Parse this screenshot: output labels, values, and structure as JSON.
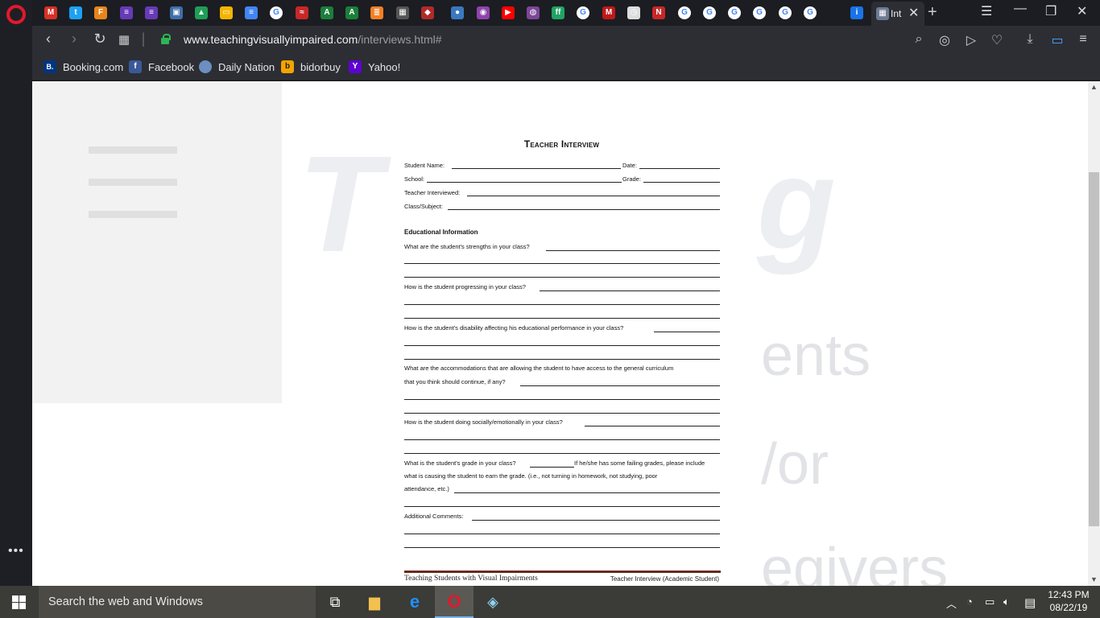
{
  "browser": {
    "active_tab_title": "Int",
    "url_host": "www.teachingvisuallyimpaired.com",
    "url_path": "/interviews.html#",
    "colors": {
      "accent": "#e3182d",
      "lock": "#2fb455",
      "toolbar": "#2c2e34"
    }
  },
  "tabs": [
    {
      "icon": "gmail-icon",
      "color": "#d93025",
      "glyph": "M"
    },
    {
      "icon": "twitter-icon",
      "color": "#1da1f2",
      "glyph": "t"
    },
    {
      "icon": "f-icon",
      "color": "#e8841a",
      "glyph": "F"
    },
    {
      "icon": "list-icon",
      "color": "#673ab7",
      "glyph": "≡"
    },
    {
      "icon": "list-icon",
      "color": "#673ab7",
      "glyph": "≡"
    },
    {
      "icon": "photo-icon",
      "color": "#3f6ea7",
      "glyph": "▣"
    },
    {
      "icon": "drive-icon",
      "color": "#1e9e57",
      "glyph": "▲"
    },
    {
      "icon": "slides-icon",
      "color": "#f4b400",
      "glyph": "▭"
    },
    {
      "icon": "docs-icon",
      "color": "#4285f4",
      "glyph": "≡"
    },
    {
      "icon": "google-icon",
      "color": "#ffffff",
      "glyph": "G"
    },
    {
      "icon": "red-icon",
      "color": "#c62828",
      "glyph": "≈"
    },
    {
      "icon": "green-icon",
      "color": "#1b7f3b",
      "glyph": "A"
    },
    {
      "icon": "green-icon",
      "color": "#1b7f3b",
      "glyph": "A"
    },
    {
      "icon": "stack-icon",
      "color": "#f48024",
      "glyph": "≣"
    },
    {
      "icon": "qr-icon",
      "color": "#555555",
      "glyph": "▦"
    },
    {
      "icon": "shield-icon",
      "color": "#b02a2a",
      "glyph": "◆"
    },
    {
      "icon": "globe-icon",
      "color": "#3b78c2",
      "glyph": "●"
    },
    {
      "icon": "podcast-icon",
      "color": "#8e44ad",
      "glyph": "◉"
    },
    {
      "icon": "youtube-icon",
      "color": "#ff0000",
      "glyph": "▶"
    },
    {
      "icon": "tor-icon",
      "color": "#7d4698",
      "glyph": "◍"
    },
    {
      "icon": "green-icon",
      "color": "#1fa463",
      "glyph": "ff"
    },
    {
      "icon": "google-icon",
      "color": "#ffffff",
      "glyph": "G"
    },
    {
      "icon": "mcafee-icon",
      "color": "#c01818",
      "glyph": "M"
    },
    {
      "icon": "clock-icon",
      "color": "#dddddd",
      "glyph": "◷"
    },
    {
      "icon": "news-icon",
      "color": "#c62828",
      "glyph": "N"
    },
    {
      "icon": "google-icon",
      "color": "#ffffff",
      "glyph": "G"
    },
    {
      "icon": "google-icon",
      "color": "#ffffff",
      "glyph": "G"
    },
    {
      "icon": "google-icon",
      "color": "#ffffff",
      "glyph": "G"
    },
    {
      "icon": "google-icon",
      "color": "#ffffff",
      "glyph": "G"
    },
    {
      "icon": "google-icon",
      "color": "#ffffff",
      "glyph": "G"
    },
    {
      "icon": "google-icon",
      "color": "#ffffff",
      "glyph": "G"
    },
    {
      "icon": "info-icon",
      "color": "#1a73e8",
      "glyph": "i"
    }
  ],
  "bookmarks": [
    {
      "label": "Booking.com",
      "icon": "booking-icon",
      "glyph": "B.",
      "color": "#003580"
    },
    {
      "label": "Facebook",
      "icon": "facebook-icon",
      "glyph": "f",
      "color": "#3b5998"
    },
    {
      "label": "Daily Nation",
      "icon": "globe-icon",
      "glyph": "●",
      "color": "#6c8fbf"
    },
    {
      "label": "bidorbuy",
      "icon": "bidorbuy-icon",
      "glyph": "b",
      "color": "#f5a300"
    },
    {
      "label": "Yahoo!",
      "icon": "yahoo-icon",
      "glyph": "Y",
      "color": "#5f01d1"
    }
  ],
  "page_bg": {
    "big_letters_1": "T",
    "big_letters_2": "g",
    "word_1": "ents",
    "word_2": "/or",
    "word_3": "egivers"
  },
  "document": {
    "title": "Teacher Interview",
    "fields": [
      {
        "label": "Student Name:",
        "right": "Date:"
      },
      {
        "label": "School:",
        "right": "Grade:"
      },
      {
        "label": "Teacher Interviewed:",
        "right": ""
      },
      {
        "label": "Class/Subject:",
        "right": ""
      }
    ],
    "section": "Educational Information",
    "questions": [
      "What are the student's strengths in your class?",
      "How is the student progressing in your class?",
      "How is the student's disability affecting his educational performance in your class?",
      "What are the accommodations that are allowing the student to have access to the general curriculum",
      "that you think should continue, if any?",
      "How is the student doing socially/emotionally in your class?",
      "What is the student's grade in your class?",
      "If he/she has some failing grades, please include",
      "what is causing the student to earn the grade. (i.e., not turning in homework, not studying, poor",
      "attendance, etc.)",
      "Additional Comments:"
    ],
    "footer_left": "Teaching Students with Visual Impairments",
    "footer_right": "Teacher Interview (Academic Student)"
  },
  "taskbar": {
    "search_placeholder": "Search the web and Windows",
    "time": "12:43 PM",
    "date": "08/22/19"
  }
}
